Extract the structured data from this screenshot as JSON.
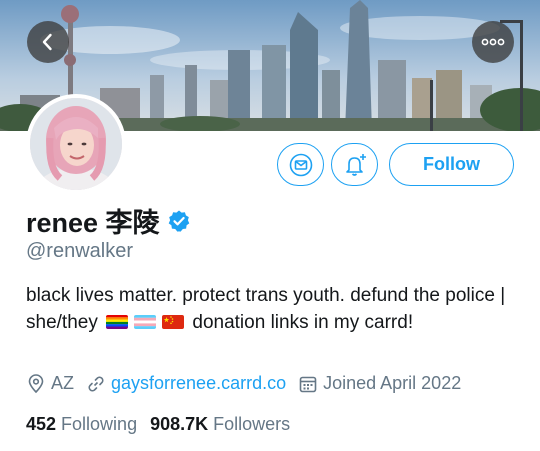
{
  "profile": {
    "display_name": "renee 李陵",
    "handle": "@renwalker",
    "bio_part1": "black lives matter. protect trans youth. defund the police | she/they",
    "bio_part2": "donation links in my carrd!",
    "location": "AZ",
    "website": "gaysforrenee.carrd.co",
    "joined": "Joined April 2022"
  },
  "stats": {
    "following_count": "452",
    "following_label": "Following",
    "followers_count": "908.7K",
    "followers_label": "Followers"
  },
  "actions": {
    "follow_label": "Follow"
  },
  "icons": {
    "back": "chevron-left-icon",
    "more": "more-horizontal-icon",
    "message": "envelope-icon",
    "notify": "bell-plus-icon",
    "verified": "verified-badge-icon",
    "location": "location-pin-icon",
    "link": "link-icon",
    "calendar": "calendar-icon"
  },
  "colors": {
    "accent": "#1da1f2",
    "secondary_text": "#657786",
    "primary_text": "#14171a"
  }
}
